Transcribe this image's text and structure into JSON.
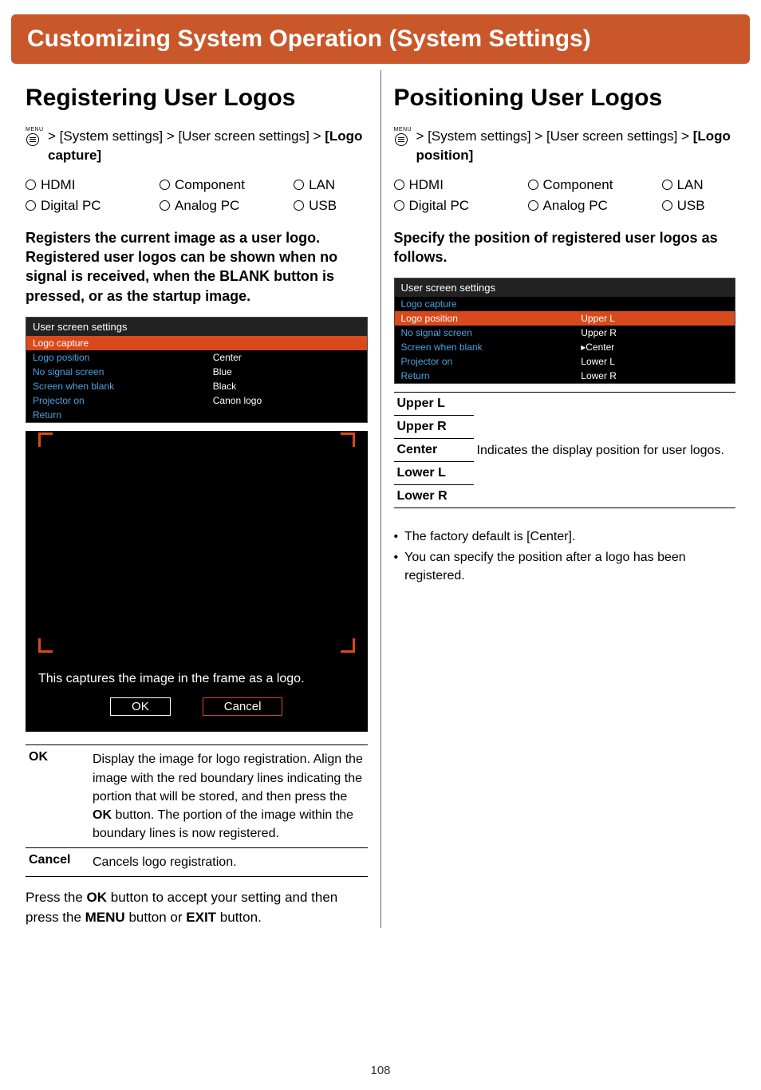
{
  "banner": "Customizing System Operation (System Settings)",
  "pageNumber": "108",
  "left": {
    "heading": "Registering User Logos",
    "pathPrefix": "> [System settings] > [User screen settings] > ",
    "pathBold": "[Logo capture]",
    "inputs": [
      "HDMI",
      "Component",
      "LAN",
      "Digital PC",
      "Analog PC",
      "USB"
    ],
    "summary": "Registers the current image as a user logo. Registered user logos can be shown when no signal is received, when the BLANK button is pressed, or as the startup image.",
    "menu": {
      "title": "User screen settings",
      "rows": [
        {
          "label": "Logo capture",
          "val": "",
          "sel": true
        },
        {
          "label": "Logo position",
          "val": "Center"
        },
        {
          "label": "No signal screen",
          "val": "Blue"
        },
        {
          "label": "Screen when blank",
          "val": "Black"
        },
        {
          "label": "Projector on",
          "val": "Canon logo"
        },
        {
          "label": "Return",
          "val": ""
        }
      ]
    },
    "captureText": "This captures the image in the frame as a logo.",
    "okLabel": "OK",
    "cancelLabel": "Cancel",
    "defs": [
      {
        "key": "OK",
        "desc": "Display the image for logo registration. Align the image with the red boundary lines indicating the portion that will be stored, and then press the OK button. The portion of the image within the boundary lines is now registered."
      },
      {
        "key": "Cancel",
        "desc": "Cancels logo registration."
      }
    ],
    "closing": {
      "pre": "Press the ",
      "b1": "OK",
      "mid": " button to accept your setting and then press the ",
      "b2": "MENU",
      "post": " button or ",
      "b3": "EXIT",
      "post2": " button."
    }
  },
  "right": {
    "heading": "Positioning User Logos",
    "pathPrefix": "> [System settings] > [User screen settings] > ",
    "pathBold": "[Logo position]",
    "inputs": [
      "HDMI",
      "Component",
      "LAN",
      "Digital PC",
      "Analog PC",
      "USB"
    ],
    "summary": "Specify the position of registered user logos as follows.",
    "menu": {
      "title": "User screen settings",
      "rows": [
        {
          "label": "Logo capture",
          "val": ""
        },
        {
          "label": "Logo position",
          "val": "Upper L",
          "sel": true
        },
        {
          "label": "No signal screen",
          "val": "Upper R",
          "opt": true
        },
        {
          "label": "Screen when blank",
          "val": "▸Center",
          "opt": true
        },
        {
          "label": "Projector on",
          "val": "Lower L",
          "opt": true
        },
        {
          "label": "Return",
          "val": "Lower R",
          "opt": true
        }
      ]
    },
    "positions": [
      "Upper L",
      "Upper R",
      "Center",
      "Lower L",
      "Lower R"
    ],
    "posDesc": "Indicates the display position for user logos.",
    "notes": [
      "The factory default is [Center].",
      "You can specify the position after a logo has been registered."
    ]
  }
}
